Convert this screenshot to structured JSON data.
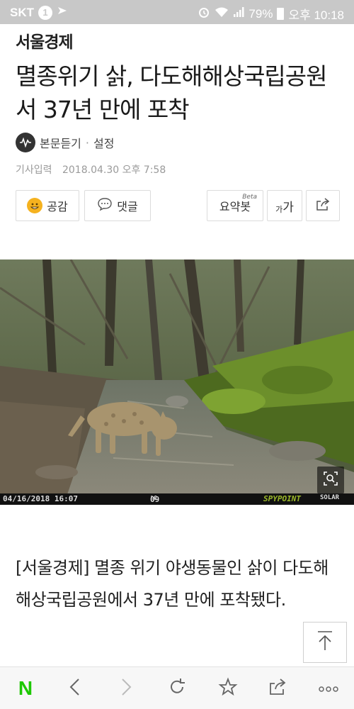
{
  "status_bar": {
    "carrier": "SKT",
    "sim_badge": "1",
    "battery": "79%",
    "time": "오후 10:18",
    "icons": [
      "alarm-icon",
      "wifi-icon",
      "signal-icon",
      "battery-icon",
      "nav-arrow-icon"
    ]
  },
  "article": {
    "brand": "서울경제",
    "headline": "멸종위기 삵, 다도해해상국립공원서 37년 만에 포착",
    "listen_label": "본문듣기",
    "separator": "·",
    "settings_label": "설정",
    "date_label": "기사입력",
    "date_value": "2018.04.30 오후 7:58",
    "body": "[서울경제] 멸종 위기 야생동물인 삵이 다도해해상국립공원에서 37년 만에 포착됐다."
  },
  "actions": {
    "like_label": "공감",
    "comment_label": "댓글",
    "summary_label": "요약봇",
    "summary_badge": "Beta",
    "font_small": "가",
    "font_large": "가"
  },
  "photo": {
    "camera_date": "04/16/2018  16:07",
    "camera_temp": "09",
    "camera_temp_unit": "°C",
    "camera_brand": "SPYPOINT",
    "camera_solar": "SOLAR",
    "zoom_icon": "zoom-icon"
  },
  "colors": {
    "status_bar": "#c8c8c8",
    "naver_green": "#1ec800",
    "like_emoji": "#f5b21f"
  }
}
